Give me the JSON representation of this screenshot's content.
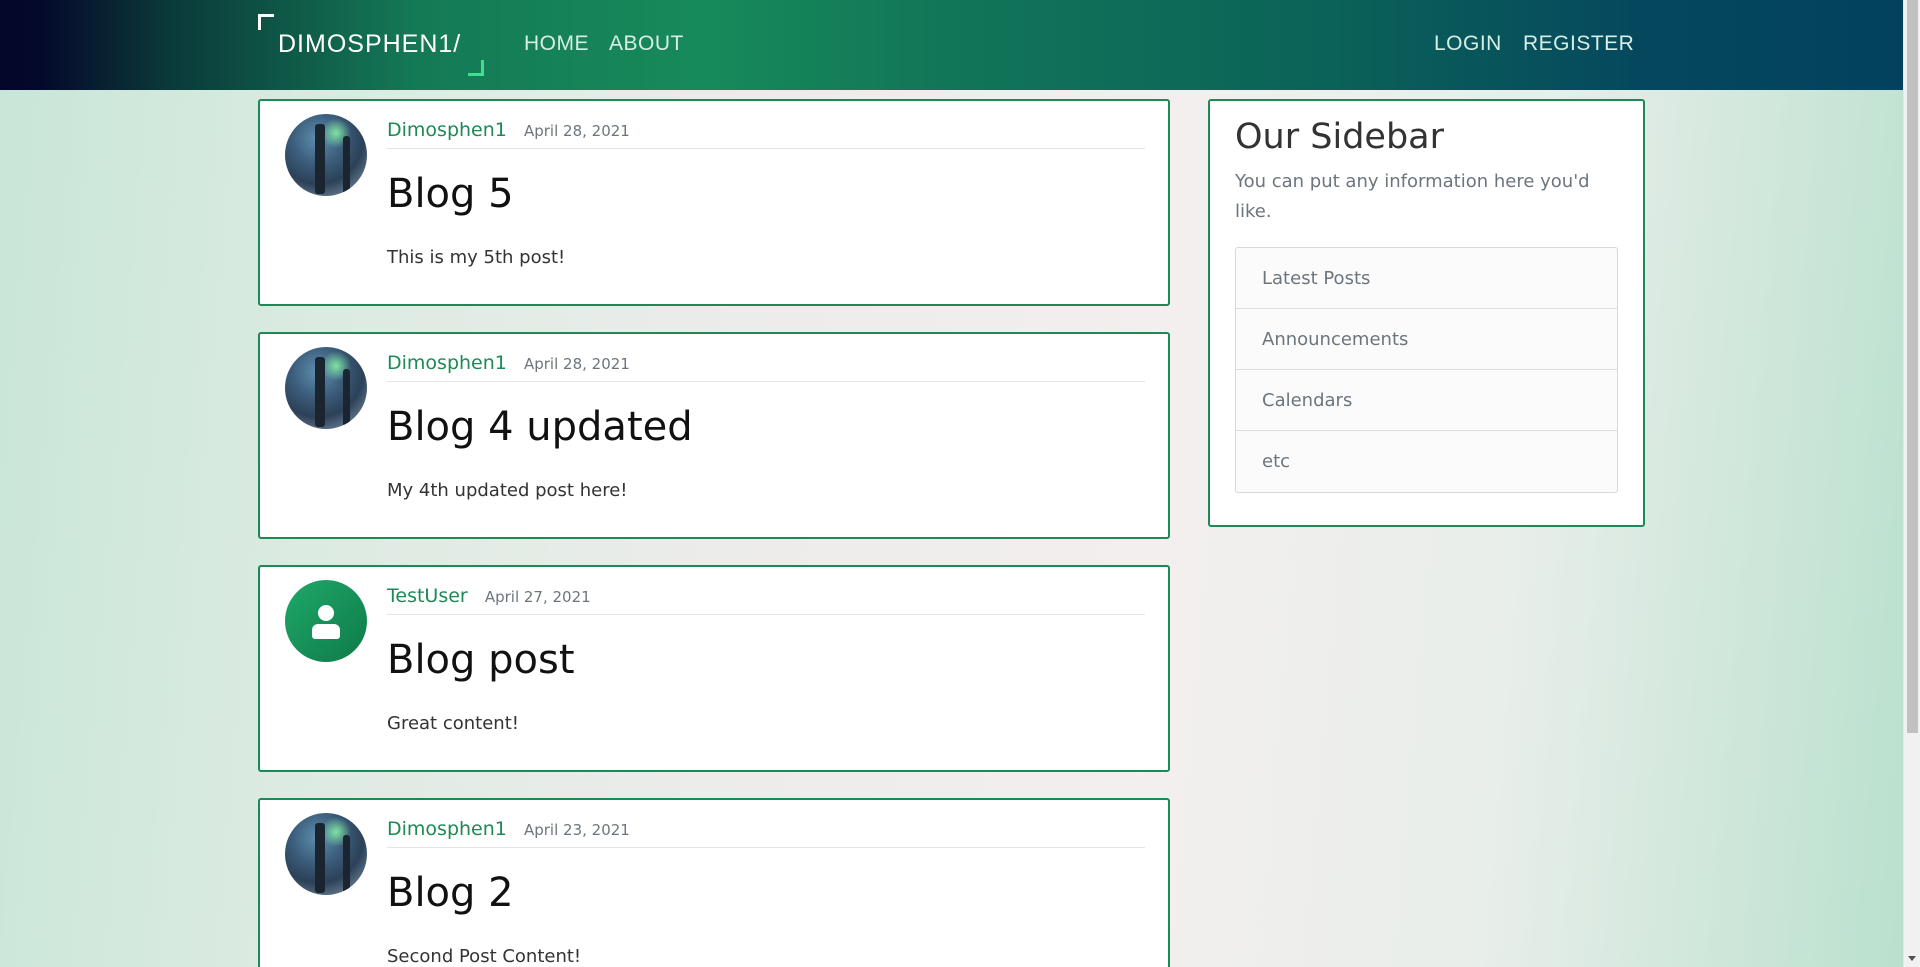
{
  "navbar": {
    "brand": "DIMOSPHEN1/",
    "left_links": [
      "HOME",
      "ABOUT"
    ],
    "right_links": [
      "LOGIN",
      "REGISTER"
    ]
  },
  "posts": [
    {
      "author": "Dimosphen1",
      "date": "April 28, 2021",
      "title": "Blog 5",
      "content": "This is my 5th post!",
      "avatar": "photo"
    },
    {
      "author": "Dimosphen1",
      "date": "April 28, 2021",
      "title": "Blog 4 updated",
      "content": "My 4th updated post here!",
      "avatar": "photo"
    },
    {
      "author": "TestUser",
      "date": "April 27, 2021",
      "title": "Blog post",
      "content": "Great content!",
      "avatar": "default-user-icon"
    },
    {
      "author": "Dimosphen1",
      "date": "April 23, 2021",
      "title": "Blog 2",
      "content": "Second Post Content!",
      "avatar": "photo"
    }
  ],
  "sidebar": {
    "title": "Our Sidebar",
    "description": "You can put any information here you'd like.",
    "items": [
      "Latest Posts",
      "Announcements",
      "Calendars",
      "etc"
    ]
  },
  "colors": {
    "accent": "#1d8a55",
    "navbar_start": "#04062a",
    "navbar_mid": "#178a5a",
    "navbar_end": "#03415e"
  }
}
